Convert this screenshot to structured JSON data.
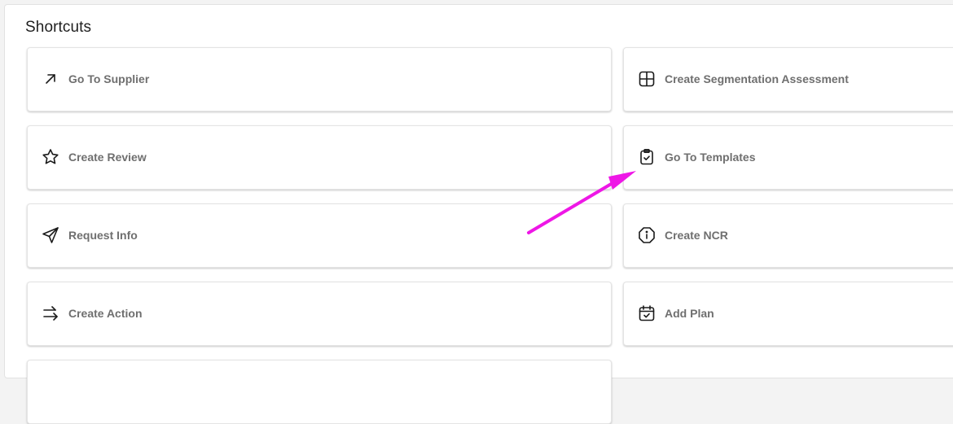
{
  "shortcuts": {
    "title": "Shortcuts",
    "left": [
      {
        "label": "Go To Supplier",
        "icon": "arrow-up-right-icon"
      },
      {
        "label": "Create Review",
        "icon": "star-icon"
      },
      {
        "label": "Request Info",
        "icon": "send-icon"
      },
      {
        "label": "Create Action",
        "icon": "arrows-right-icon"
      }
    ],
    "right": [
      {
        "label": "Create Segmentation Assessment",
        "icon": "grid-icon"
      },
      {
        "label": "Go To Templates",
        "icon": "clipboard-check-icon"
      },
      {
        "label": "Create NCR",
        "icon": "octagon-info-icon"
      },
      {
        "label": "Add Plan",
        "icon": "calendar-check-icon"
      }
    ]
  },
  "annotation": {
    "arrow_color": "#ee17e6"
  }
}
